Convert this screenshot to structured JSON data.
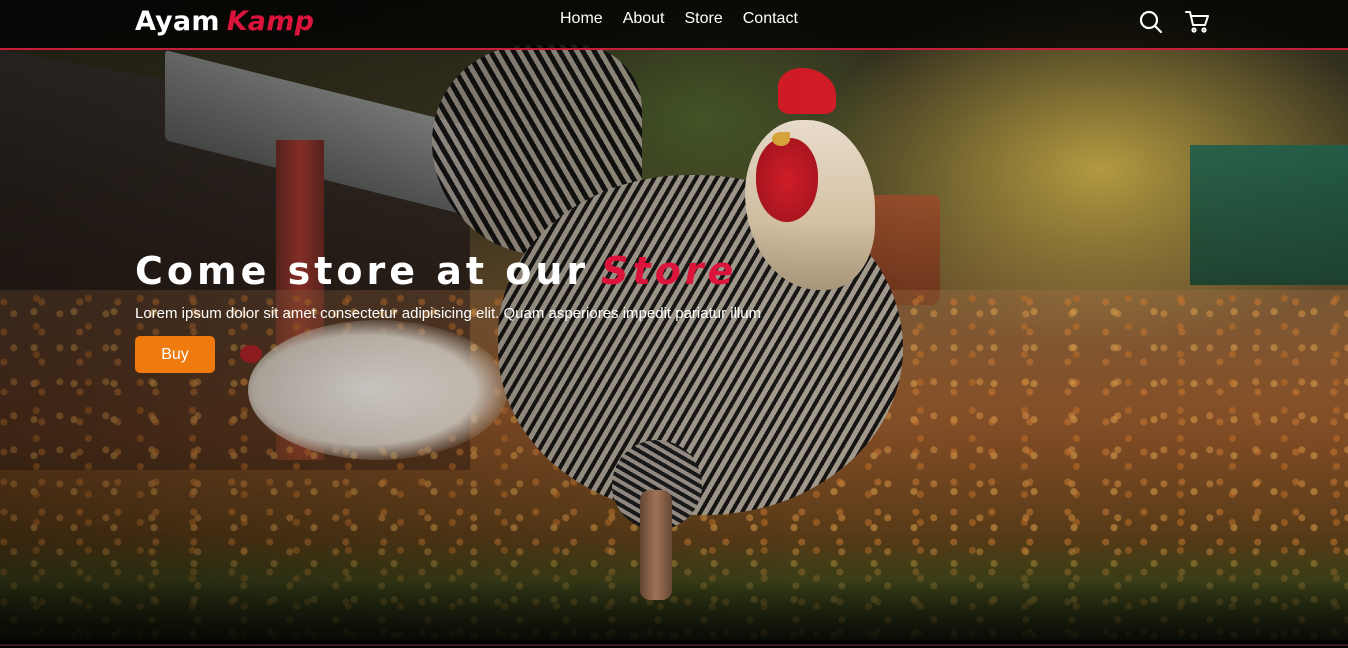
{
  "navbar": {
    "logo_main": "Ayam",
    "logo_accent": "Kamp",
    "links": [
      "Home",
      "About",
      "Store",
      "Contact"
    ],
    "icons": [
      "search-icon",
      "cart-icon"
    ],
    "accent_color": "#dc143c"
  },
  "hero": {
    "title_main": "Come store at our",
    "title_accent": "Store",
    "description": "Lorem ipsum dolor sit amet consectetur adipisicing elit. Quam asperiores impedit pariatur illum",
    "buy_label": "Buy",
    "buy_color": "#ef7b0e"
  }
}
